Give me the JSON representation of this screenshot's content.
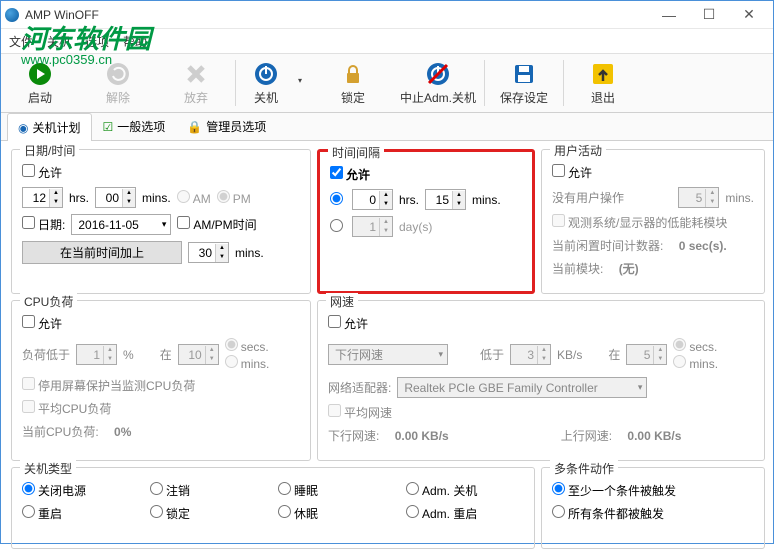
{
  "window": {
    "title": "AMP WinOFF"
  },
  "menu": {
    "file": "文件",
    "shutdown": "关机",
    "options": "选项",
    "help": "帮助"
  },
  "watermark": {
    "brand": "河东软件园",
    "url": "www.pc0359.cn"
  },
  "toolbar": {
    "start": "启动",
    "release": "解除",
    "abandon": "放弃",
    "shutdown": "关机",
    "lock": "锁定",
    "abort": "中止Adm.关机",
    "save": "保存设定",
    "exit": "退出"
  },
  "tabs": {
    "plan": "关机计划",
    "general": "一般选项",
    "admin": "管理员选项"
  },
  "datetime": {
    "title": "日期/时间",
    "allow": "允许",
    "hours": "12",
    "hrs": "hrs.",
    "minutes": "00",
    "mins": "mins.",
    "am": "AM",
    "pm": "PM",
    "date_label": "日期:",
    "date_value": "2016-11-05",
    "ampm_time": "AM/PM时间",
    "add_button": "在当前时间加上",
    "add_value": "30"
  },
  "interval": {
    "title": "时间间隔",
    "allow": "允许",
    "hours": "0",
    "hrs": "hrs.",
    "minutes": "15",
    "mins": "mins.",
    "days_value": "1",
    "days_label": "day(s)"
  },
  "activity": {
    "title": "用户活动",
    "allow": "允许",
    "no_op": "没有用户操作",
    "value": "5",
    "mins": "mins.",
    "monitor": "观测系统/显示器的低能耗模块",
    "idle_label": "当前闲置时间计数器:",
    "idle_value": "0 sec(s).",
    "module_label": "当前模块:",
    "module_value": "(无)"
  },
  "cpu": {
    "title": "CPU负荷",
    "allow": "允许",
    "less_than": "负荷低于",
    "percent_value": "1",
    "percent": "%",
    "in": "在",
    "in_value": "10",
    "secs": "secs.",
    "mins": "mins.",
    "disable_saver": "停用屏幕保护当监测CPU负荷",
    "average": "平均CPU负荷",
    "current_label": "当前CPU负荷:",
    "current_value": "0%"
  },
  "net": {
    "title": "网速",
    "allow": "允许",
    "direction": "下行网速",
    "below": "低于",
    "below_value": "3",
    "kbs": "KB/s",
    "in": "在",
    "in_value": "5",
    "secs": "secs.",
    "mins": "mins.",
    "adapter_label": "网络适配器:",
    "adapter_value": "Realtek PCIe GBE Family Controller",
    "average": "平均网速",
    "down_label": "下行网速:",
    "down_value": "0.00 KB/s",
    "up_label": "上行网速:",
    "up_value": "0.00 KB/s"
  },
  "shutdown_type": {
    "title": "关机类型",
    "poweroff": "关闭电源",
    "logout": "注销",
    "sleep": "睡眠",
    "adm_shutdown": "Adm. 关机",
    "reboot": "重启",
    "lock": "锁定",
    "hibernate": "休眠",
    "adm_reboot": "Adm. 重启"
  },
  "multi": {
    "title": "多条件动作",
    "at_least_one": "至少一个条件被触发",
    "all": "所有条件都被触发"
  }
}
